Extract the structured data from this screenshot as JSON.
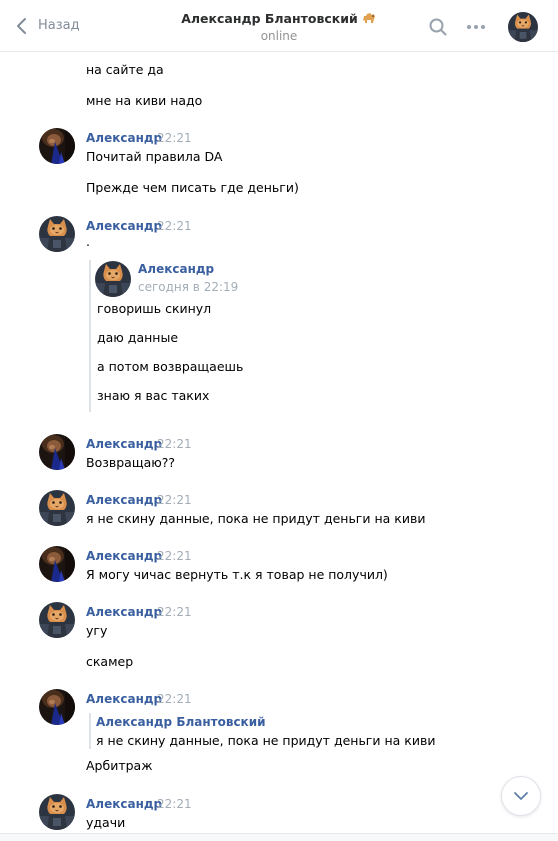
{
  "header": {
    "back_label": "Назад",
    "title": "Александр Блантовский",
    "status": "online"
  },
  "messages": {
    "m0_t1": "на сайте да",
    "m0_t2": "мне на киви надо",
    "m1_author": "Александр",
    "m1_time": "22:21",
    "m1_t1": "Почитай правила DA",
    "m1_t2": "Прежде чем писать где деньги)",
    "m2_author": "Александр",
    "m2_time": "22:21",
    "m2_t1": ".",
    "m2_fwd": {
      "author": "Александр",
      "time": "сегодня в 22:19",
      "t1": "говоришь скинул",
      "t2": "даю данные",
      "t3": "а потом возвращаешь",
      "t4": "знаю я вас таких"
    },
    "m3_author": "Александр",
    "m3_time": "22:21",
    "m3_t1": "Возвращаю??",
    "m4_author": "Александр",
    "m4_time": "22:21",
    "m4_t1": "я не скину данные, пока не придут деньги на киви",
    "m5_author": "Александр",
    "m5_time": "22:21",
    "m5_t1": "Я могу чичас вернуть т.к я товар не получил)",
    "m6_author": "Александр",
    "m6_time": "22:21",
    "m6_t1": "угу",
    "m6_t2": "скамер",
    "m7_author": "Александр",
    "m7_time": "22:21",
    "m7_reply": {
      "author": "Александр Блантовский",
      "text": "я не скину данные, пока не придут деньги на киви"
    },
    "m7_t1": "Арбитраж",
    "m8_author": "Александр",
    "m8_time": "22:21",
    "m8_t1": "удачи"
  },
  "colors": {
    "author": "#3a5fa0",
    "muted": "#a3adb8",
    "accent": "#818c99"
  },
  "icons": {
    "back": "chevron-left-icon",
    "search": "search-icon",
    "more": "more-dots-icon",
    "scroll": "chevron-down-icon"
  }
}
